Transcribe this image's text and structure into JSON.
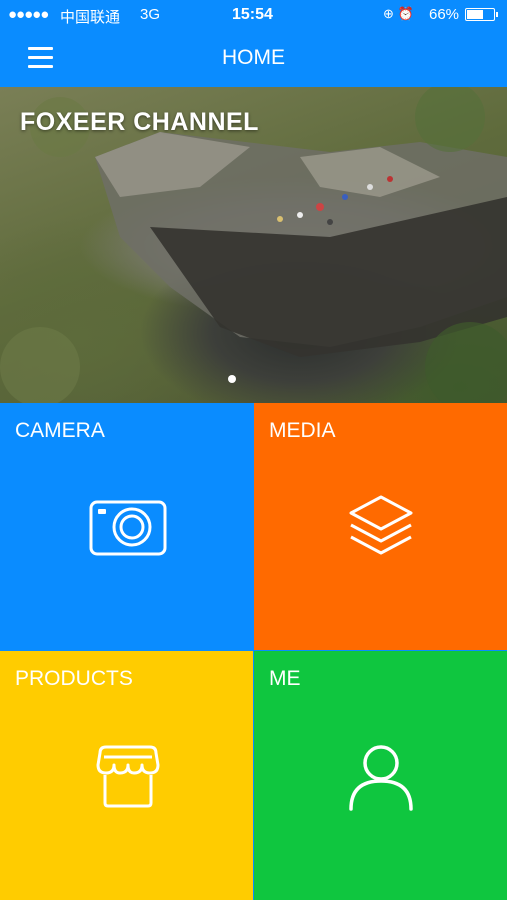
{
  "status_bar": {
    "signal_dots": "●●●●●",
    "carrier": "中国联通",
    "network": "3G",
    "time": "15:54",
    "indicators": "⊕ ⏰",
    "battery_percent": "66%",
    "battery_level": 0.66
  },
  "nav": {
    "title": "HOME"
  },
  "banner": {
    "title": "FOXEER CHANNEL",
    "pages": 1,
    "active_page": 1
  },
  "tiles": [
    {
      "label": "CAMERA",
      "icon": "camera-icon",
      "color": "#0a8cff"
    },
    {
      "label": "MEDIA",
      "icon": "layers-icon",
      "color": "#ff6a00"
    },
    {
      "label": "PRODUCTS",
      "icon": "store-icon",
      "color": "#ffcc00"
    },
    {
      "label": "ME",
      "icon": "user-icon",
      "color": "#0fc63f"
    }
  ]
}
